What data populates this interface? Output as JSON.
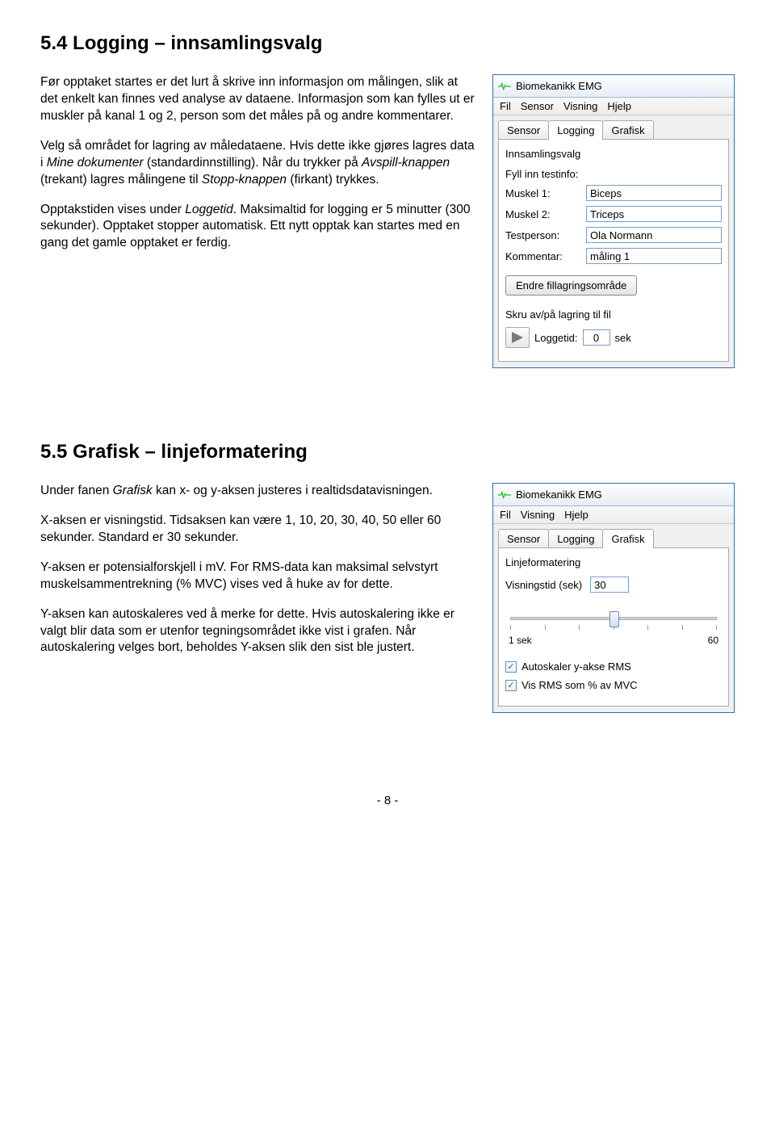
{
  "section54": {
    "heading": "5.4 Logging – innsamlingsvalg",
    "p1_a": "Før opptaket startes er det lurt å skrive inn informasjon om målingen, slik at det enkelt kan finnes ved analyse av dataene. Informasjon som kan fylles ut er muskler på kanal 1 og 2, person som det måles på og andre kommentarer.",
    "p2_a": "Velg så området for lagring av måledataene. Hvis dette ikke gjøres lagres data i ",
    "p2_i1": "Mine dokumenter",
    "p2_b": " (standardinnstilling). Når du trykker på ",
    "p2_i2": "Avspill-knappen",
    "p2_c": " (trekant) lagres målingene til ",
    "p2_i3": "Stopp-knappen",
    "p2_d": " (firkant) trykkes.",
    "p3_a": "Opptakstiden vises under ",
    "p3_i1": "Loggetid",
    "p3_b": ". Maksimaltid for logging er 5 minutter (300 sekunder). Opptaket stopper automatisk. Ett nytt opptak kan startes med en gang det gamle opptaket er ferdig."
  },
  "app1": {
    "title": "Biomekanikk EMG",
    "menu": [
      "Fil",
      "Sensor",
      "Visning",
      "Hjelp"
    ],
    "tabs": [
      "Sensor",
      "Logging",
      "Grafisk"
    ],
    "active_tab": "Logging",
    "panel_title": "Innsamlingsvalg",
    "testinfo_label": "Fyll inn testinfo:",
    "fields": {
      "m1_lbl": "Muskel 1:",
      "m1_val": "Biceps",
      "m2_lbl": "Muskel 2:",
      "m2_val": "Triceps",
      "tp_lbl": "Testperson:",
      "tp_val": "Ola Normann",
      "km_lbl": "Kommentar:",
      "km_val": "måling 1"
    },
    "change_btn": "Endre fillagringsområde",
    "toggle_label": "Skru av/på lagring til fil",
    "loggetid_lbl": "Loggetid:",
    "loggetid_val": "0",
    "loggetid_unit": "sek"
  },
  "section55": {
    "heading": "5.5 Grafisk – linjeformatering",
    "p1_a": "Under fanen ",
    "p1_i1": "Grafisk",
    "p1_b": " kan x- og y-aksen justeres i realtidsdatavisningen.",
    "p2": "X-aksen er visningstid. Tidsaksen kan være 1, 10, 20, 30, 40, 50 eller 60 sekunder. Standard er 30 sekunder.",
    "p3": "Y-aksen er potensialforskjell i mV. For RMS-data kan maksimal selvstyrt muskelsammentrekning (% MVC) vises ved å huke av for dette.",
    "p4": "Y-aksen kan autoskaleres ved å merke for dette. Hvis autoskalering ikke er valgt blir data som er utenfor tegningsområdet ikke vist i grafen. Når autoskalering velges bort, beholdes Y-aksen slik den sist ble justert."
  },
  "app2": {
    "title": "Biomekanikk EMG",
    "menu": [
      "Fil",
      "Visning",
      "Hjelp"
    ],
    "tabs": [
      "Sensor",
      "Logging",
      "Grafisk"
    ],
    "active_tab": "Grafisk",
    "panel_title": "Linjeformatering",
    "visningstid_lbl": "Visningstid (sek)",
    "visningstid_val": "30",
    "slider_min": "1 sek",
    "slider_max": "60",
    "cb1": "Autoskaler y-akse RMS",
    "cb2": "Vis RMS som % av MVC"
  },
  "page_number": "- 8 -"
}
